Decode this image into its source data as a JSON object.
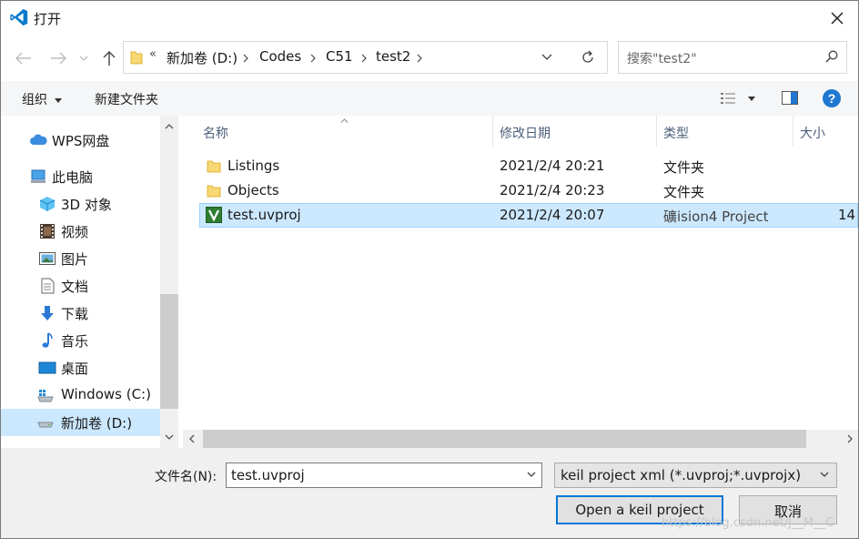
{
  "window": {
    "title": "打开"
  },
  "address": {
    "overflow": "«",
    "crumbs": [
      "新加卷 (D:)",
      "Codes",
      "C51",
      "test2"
    ]
  },
  "search": {
    "placeholder": "搜索\"test2\""
  },
  "toolbar": {
    "organize": "组织",
    "new_folder": "新建文件夹"
  },
  "sidebar": {
    "items": [
      {
        "label": "WPS网盘",
        "icon": "cloud-icon"
      },
      {
        "label": "此电脑",
        "icon": "computer-icon"
      },
      {
        "label": "3D 对象",
        "icon": "3d-objects-icon"
      },
      {
        "label": "视频",
        "icon": "video-icon"
      },
      {
        "label": "图片",
        "icon": "picture-icon"
      },
      {
        "label": "文档",
        "icon": "document-icon"
      },
      {
        "label": "下载",
        "icon": "download-icon"
      },
      {
        "label": "音乐",
        "icon": "music-icon"
      },
      {
        "label": "桌面",
        "icon": "desktop-icon"
      },
      {
        "label": "Windows (C:)",
        "icon": "drive-c-icon"
      },
      {
        "label": "新加卷 (D:)",
        "icon": "drive-d-icon",
        "selected": true
      }
    ]
  },
  "columns": {
    "name": "名称",
    "date": "修改日期",
    "type": "类型",
    "size": "大小"
  },
  "files": [
    {
      "name": "Listings",
      "date": "2021/2/4 20:21",
      "type": "文件夹",
      "size": ""
    },
    {
      "name": "Objects",
      "date": "2021/2/4 20:23",
      "type": "文件夹",
      "size": ""
    },
    {
      "name": "test.uvproj",
      "date": "2021/2/4 20:07",
      "type": "礦ision4 Project",
      "size": "14",
      "selected": true
    }
  ],
  "footer": {
    "filename_label": "文件名(N):",
    "filename_value": "test.uvproj",
    "filetype": "keil project xml (*.uvproj;*.uvprojx)",
    "open_button": "Open a keil project",
    "cancel_button": "取消"
  },
  "watermark": "https://blog.csdn.net/J__M__C",
  "colors": {
    "accent": "#0078d7",
    "selection": "#cce8ff",
    "folder": "#f8d775"
  }
}
